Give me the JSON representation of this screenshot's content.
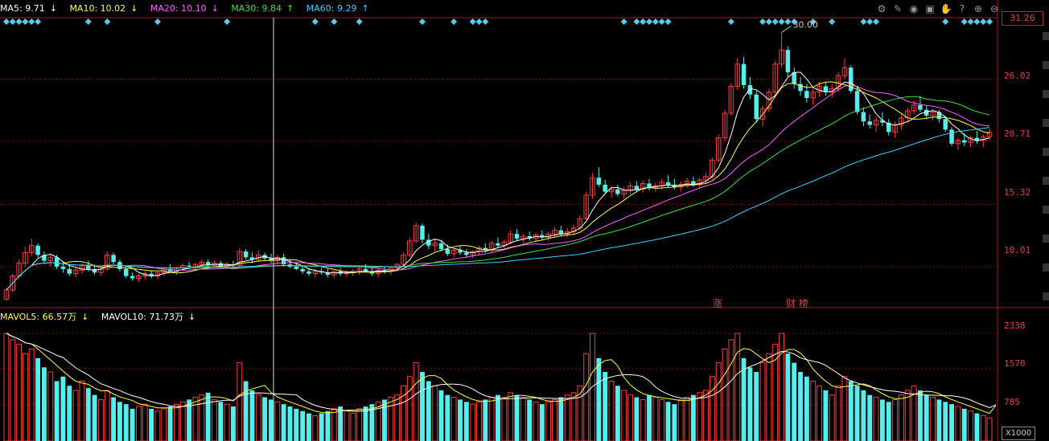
{
  "legend_top": {
    "ma5": {
      "label": "MA5: 9.71",
      "arrow": "↓",
      "color": "#ffffff"
    },
    "ma10": {
      "label": "MA10: 10.02",
      "arrow": "↓",
      "color": "#ffff40"
    },
    "ma20": {
      "label": "MA20: 10.10",
      "arrow": "↓",
      "color": "#ff60ff"
    },
    "ma30": {
      "label": "MA30: 9.84",
      "arrow": "↑",
      "color": "#40e040"
    },
    "ma60": {
      "label": "MA60: 9.29",
      "arrow": "↑",
      "color": "#40d0ff"
    }
  },
  "legend_vol": {
    "mavol5": {
      "label": "MAVOL5: 66.57万",
      "arrow": "↓",
      "color": "#ffff40"
    },
    "mavol10": {
      "label": "MAVOL10: 71.73万",
      "arrow": "↓",
      "color": "#ffffff"
    }
  },
  "toolbar_icons": [
    "settings-icon",
    "draw-icon",
    "eye-icon",
    "save-icon",
    "hand-icon",
    "help-icon",
    "zoom-in-icon",
    "zoom-out-icon"
  ],
  "axis_price_labels": [
    "31.26",
    "26.02",
    "20.71",
    "15.32",
    "10.01"
  ],
  "axis_vol_labels": [
    "2338",
    "1570",
    "785"
  ],
  "volume_unit": "X1000",
  "high_marker": "30.00",
  "event_markers": [
    {
      "text": "涨"
    },
    {
      "text": "财 榜"
    }
  ],
  "colors": {
    "up": "#ff3b3b",
    "down": "#55eeee",
    "grid": "#7a1010",
    "background": "#000000"
  },
  "chart_data": {
    "type": "candlestick",
    "price_axis": {
      "min": 6.5,
      "max": 31.26,
      "ticks": [
        31.26,
        26.02,
        20.71,
        15.32,
        10.01
      ]
    },
    "volume_axis": {
      "min": 0,
      "max": 2600,
      "ticks": [
        2338,
        1570,
        785
      ]
    },
    "high_label_value": 30.0,
    "ohlc": [
      [
        7.2,
        8.2,
        7.1,
        8.0
      ],
      [
        8.0,
        9.4,
        7.8,
        9.2
      ],
      [
        9.2,
        10.6,
        9.0,
        10.3
      ],
      [
        10.3,
        11.7,
        10.0,
        11.2
      ],
      [
        11.2,
        12.4,
        10.9,
        11.8
      ],
      [
        11.8,
        12.0,
        10.8,
        11.0
      ],
      [
        11.0,
        11.3,
        10.3,
        10.5
      ],
      [
        10.5,
        11.0,
        10.0,
        10.8
      ],
      [
        10.8,
        11.0,
        9.8,
        10.0
      ],
      [
        10.0,
        10.4,
        9.5,
        9.8
      ],
      [
        9.8,
        10.2,
        9.2,
        9.4
      ],
      [
        9.4,
        9.9,
        9.1,
        9.7
      ],
      [
        9.7,
        10.3,
        9.4,
        10.1
      ],
      [
        10.1,
        10.5,
        9.6,
        9.8
      ],
      [
        9.8,
        10.2,
        9.3,
        9.5
      ],
      [
        9.5,
        10.0,
        9.2,
        9.8
      ],
      [
        9.8,
        11.3,
        9.7,
        11.0
      ],
      [
        11.0,
        11.2,
        10.2,
        10.4
      ],
      [
        10.4,
        10.6,
        9.6,
        9.8
      ],
      [
        9.8,
        10.0,
        9.0,
        9.2
      ],
      [
        9.2,
        9.5,
        8.8,
        9.0
      ],
      [
        9.0,
        9.4,
        8.7,
        9.2
      ],
      [
        9.2,
        9.6,
        8.9,
        9.4
      ],
      [
        9.4,
        9.7,
        9.0,
        9.2
      ],
      [
        9.2,
        9.6,
        8.9,
        9.5
      ],
      [
        9.5,
        9.9,
        9.2,
        9.8
      ],
      [
        9.8,
        10.2,
        9.5,
        9.6
      ],
      [
        9.6,
        10.0,
        9.3,
        9.9
      ],
      [
        9.9,
        10.3,
        9.6,
        10.1
      ],
      [
        10.1,
        10.4,
        9.8,
        10.0
      ],
      [
        10.0,
        10.3,
        9.7,
        10.2
      ],
      [
        10.2,
        10.6,
        9.9,
        10.4
      ],
      [
        10.4,
        10.6,
        10.0,
        10.1
      ],
      [
        10.1,
        10.5,
        9.9,
        10.3
      ],
      [
        10.3,
        10.5,
        9.9,
        10.0
      ],
      [
        10.0,
        10.4,
        9.8,
        10.2
      ],
      [
        10.2,
        10.5,
        9.9,
        10.1
      ],
      [
        10.1,
        11.6,
        10.0,
        11.3
      ],
      [
        11.3,
        11.5,
        10.6,
        10.8
      ],
      [
        10.8,
        11.2,
        10.3,
        10.6
      ],
      [
        10.6,
        11.4,
        10.4,
        11.0
      ],
      [
        11.0,
        11.2,
        10.5,
        10.7
      ],
      [
        10.7,
        11.1,
        10.3,
        10.5
      ],
      [
        10.5,
        11.0,
        10.2,
        10.8
      ],
      [
        10.8,
        11.1,
        10.0,
        10.2
      ],
      [
        10.2,
        10.6,
        9.9,
        10.0
      ],
      [
        10.0,
        10.4,
        9.7,
        9.8
      ],
      [
        9.8,
        10.1,
        9.4,
        9.6
      ],
      [
        9.6,
        9.9,
        9.2,
        9.4
      ],
      [
        9.4,
        9.8,
        9.1,
        9.6
      ],
      [
        9.6,
        9.9,
        9.3,
        9.5
      ],
      [
        9.5,
        9.8,
        9.1,
        9.3
      ],
      [
        9.3,
        9.7,
        9.0,
        9.6
      ],
      [
        9.6,
        9.9,
        9.2,
        9.4
      ],
      [
        9.4,
        9.7,
        9.1,
        9.5
      ],
      [
        9.5,
        9.8,
        9.2,
        9.6
      ],
      [
        9.6,
        10.0,
        9.3,
        9.8
      ],
      [
        9.8,
        10.2,
        9.5,
        9.6
      ],
      [
        9.6,
        10.0,
        9.2,
        9.4
      ],
      [
        9.4,
        9.8,
        9.1,
        9.7
      ],
      [
        9.7,
        10.0,
        9.4,
        9.6
      ],
      [
        9.6,
        10.0,
        9.3,
        9.9
      ],
      [
        9.9,
        10.3,
        9.6,
        10.2
      ],
      [
        10.2,
        11.2,
        10.0,
        11.0
      ],
      [
        11.0,
        12.5,
        10.8,
        12.2
      ],
      [
        12.2,
        13.8,
        12.0,
        13.5
      ],
      [
        13.5,
        13.7,
        12.0,
        12.3
      ],
      [
        12.3,
        12.8,
        11.5,
        11.8
      ],
      [
        11.8,
        12.4,
        11.2,
        12.0
      ],
      [
        12.0,
        12.2,
        11.3,
        11.5
      ],
      [
        11.5,
        11.9,
        10.9,
        11.1
      ],
      [
        11.1,
        11.6,
        10.8,
        11.4
      ],
      [
        11.4,
        11.8,
        11.0,
        11.2
      ],
      [
        11.2,
        11.5,
        10.8,
        11.0
      ],
      [
        11.0,
        11.4,
        10.7,
        11.3
      ],
      [
        11.3,
        11.8,
        11.0,
        11.6
      ],
      [
        11.6,
        12.0,
        11.2,
        11.4
      ],
      [
        11.4,
        12.2,
        11.2,
        12.0
      ],
      [
        12.0,
        12.5,
        11.6,
        11.8
      ],
      [
        11.8,
        12.3,
        11.5,
        12.1
      ],
      [
        12.1,
        13.1,
        11.9,
        12.8
      ],
      [
        12.8,
        13.2,
        12.2,
        12.4
      ],
      [
        12.4,
        12.8,
        12.0,
        12.6
      ],
      [
        12.6,
        13.0,
        12.2,
        12.4
      ],
      [
        12.4,
        12.9,
        12.1,
        12.7
      ],
      [
        12.7,
        13.1,
        12.3,
        12.5
      ],
      [
        12.5,
        13.0,
        12.2,
        12.8
      ],
      [
        12.8,
        13.4,
        12.5,
        13.1
      ],
      [
        13.1,
        13.5,
        12.6,
        12.8
      ],
      [
        12.8,
        13.3,
        12.5,
        13.0
      ],
      [
        13.0,
        13.6,
        12.7,
        13.3
      ],
      [
        13.3,
        14.4,
        13.1,
        14.1
      ],
      [
        14.1,
        16.4,
        14.0,
        16.1
      ],
      [
        16.1,
        18.0,
        15.8,
        17.6
      ],
      [
        17.6,
        18.5,
        16.8,
        17.0
      ],
      [
        17.0,
        17.4,
        16.2,
        16.4
      ],
      [
        16.4,
        16.9,
        15.9,
        16.6
      ],
      [
        16.6,
        17.0,
        16.0,
        16.2
      ],
      [
        16.2,
        16.8,
        15.8,
        16.5
      ],
      [
        16.5,
        17.2,
        16.2,
        16.9
      ],
      [
        16.9,
        17.3,
        16.4,
        16.6
      ],
      [
        16.6,
        17.4,
        16.3,
        17.1
      ],
      [
        17.1,
        17.5,
        16.5,
        16.7
      ],
      [
        16.7,
        17.2,
        16.4,
        16.9
      ],
      [
        16.9,
        17.5,
        16.6,
        17.2
      ],
      [
        17.2,
        17.8,
        16.8,
        17.0
      ],
      [
        17.0,
        17.5,
        16.6,
        16.8
      ],
      [
        16.8,
        17.3,
        16.4,
        17.0
      ],
      [
        17.0,
        17.6,
        16.7,
        17.3
      ],
      [
        17.3,
        17.7,
        16.8,
        17.0
      ],
      [
        17.0,
        17.6,
        16.7,
        17.4
      ],
      [
        17.4,
        18.0,
        17.1,
        17.7
      ],
      [
        17.7,
        19.3,
        17.5,
        19.1
      ],
      [
        19.1,
        21.3,
        18.9,
        21.0
      ],
      [
        21.0,
        23.4,
        20.7,
        23.1
      ],
      [
        23.1,
        25.7,
        22.9,
        25.4
      ],
      [
        25.4,
        27.8,
        25.1,
        27.3
      ],
      [
        27.3,
        27.9,
        25.2,
        25.5
      ],
      [
        25.5,
        26.2,
        24.3,
        24.7
      ],
      [
        24.7,
        25.0,
        22.3,
        22.6
      ],
      [
        22.6,
        23.8,
        22.0,
        23.5
      ],
      [
        23.5,
        25.2,
        23.2,
        24.9
      ],
      [
        24.9,
        27.6,
        24.6,
        27.3
      ],
      [
        27.3,
        30.0,
        27.0,
        28.5
      ],
      [
        28.5,
        28.8,
        26.2,
        26.6
      ],
      [
        26.6,
        27.0,
        25.2,
        25.6
      ],
      [
        25.6,
        26.2,
        24.6,
        25.0
      ],
      [
        25.0,
        25.6,
        24.0,
        24.4
      ],
      [
        24.4,
        25.2,
        23.8,
        24.9
      ],
      [
        24.9,
        25.8,
        24.5,
        25.4
      ],
      [
        25.4,
        25.8,
        24.6,
        24.9
      ],
      [
        24.9,
        25.6,
        24.4,
        25.2
      ],
      [
        25.2,
        26.6,
        24.9,
        26.3
      ],
      [
        26.3,
        27.8,
        26.0,
        27.0
      ],
      [
        27.0,
        27.2,
        24.8,
        25.0
      ],
      [
        25.0,
        25.4,
        23.0,
        23.2
      ],
      [
        23.2,
        23.6,
        22.0,
        22.4
      ],
      [
        22.4,
        23.0,
        21.8,
        22.1
      ],
      [
        22.1,
        22.8,
        21.5,
        22.5
      ],
      [
        22.5,
        23.2,
        22.0,
        22.3
      ],
      [
        22.3,
        22.6,
        21.2,
        21.5
      ],
      [
        21.5,
        22.4,
        21.0,
        22.1
      ],
      [
        22.1,
        23.0,
        21.7,
        22.7
      ],
      [
        22.7,
        23.6,
        22.3,
        23.3
      ],
      [
        23.3,
        24.2,
        23.0,
        23.8
      ],
      [
        23.8,
        24.6,
        23.2,
        23.4
      ],
      [
        23.4,
        23.8,
        22.6,
        22.9
      ],
      [
        22.9,
        23.5,
        22.5,
        23.2
      ],
      [
        23.2,
        23.4,
        22.3,
        22.6
      ],
      [
        22.6,
        22.9,
        21.5,
        21.7
      ],
      [
        21.7,
        21.9,
        20.3,
        20.5
      ],
      [
        20.5,
        21.0,
        20.0,
        20.8
      ],
      [
        20.8,
        21.4,
        20.3,
        20.6
      ],
      [
        20.6,
        21.2,
        20.2,
        21.0
      ],
      [
        21.0,
        21.6,
        20.5,
        20.8
      ],
      [
        20.8,
        21.3,
        20.2,
        21.1
      ],
      [
        21.1,
        21.8,
        20.8,
        21.5
      ]
    ],
    "volume": [
      2338,
      2200,
      2100,
      1900,
      2000,
      1800,
      1600,
      1500,
      1300,
      1400,
      1200,
      1100,
      1300,
      1150,
      1000,
      900,
      1100,
      950,
      850,
      800,
      700,
      750,
      800,
      700,
      650,
      700,
      750,
      800,
      850,
      900,
      950,
      1000,
      1050,
      900,
      850,
      800,
      750,
      1700,
      1300,
      1100,
      1000,
      950,
      900,
      850,
      800,
      750,
      700,
      650,
      600,
      550,
      600,
      650,
      700,
      750,
      650,
      600,
      700,
      750,
      800,
      850,
      900,
      950,
      1000,
      1200,
      1400,
      1700,
      1500,
      1300,
      1200,
      1100,
      1000,
      950,
      900,
      850,
      800,
      850,
      900,
      950,
      1000,
      950,
      1050,
      1000,
      950,
      900,
      850,
      800,
      850,
      900,
      950,
      1000,
      1050,
      1200,
      1900,
      2338,
      1800,
      1500,
      1300,
      1200,
      1100,
      1000,
      950,
      900,
      1000,
      950,
      900,
      850,
      800,
      900,
      950,
      1000,
      1050,
      1100,
      1400,
      1700,
      2000,
      2200,
      2338,
      1800,
      1600,
      1500,
      1700,
      1900,
      2100,
      2338,
      1900,
      1700,
      1500,
      1400,
      1300,
      1200,
      1100,
      1000,
      1200,
      1400,
      1300,
      1200,
      1100,
      1000,
      950,
      900,
      850,
      900,
      1000,
      1100,
      1200,
      1100,
      1000,
      950,
      900,
      850,
      800,
      750,
      700,
      650,
      600,
      550,
      500,
      1570
    ],
    "ma_series": [
      {
        "name": "MA5",
        "color": "#ffffff"
      },
      {
        "name": "MA10",
        "color": "#ffff40"
      },
      {
        "name": "MA20",
        "color": "#ff60ff"
      },
      {
        "name": "MA30",
        "color": "#40e040"
      },
      {
        "name": "MA60",
        "color": "#40d0ff"
      }
    ],
    "vol_ma_series": [
      {
        "name": "MAVOL5",
        "color": "#ffff40"
      },
      {
        "name": "MAVOL10",
        "color": "#ffffff"
      }
    ]
  }
}
